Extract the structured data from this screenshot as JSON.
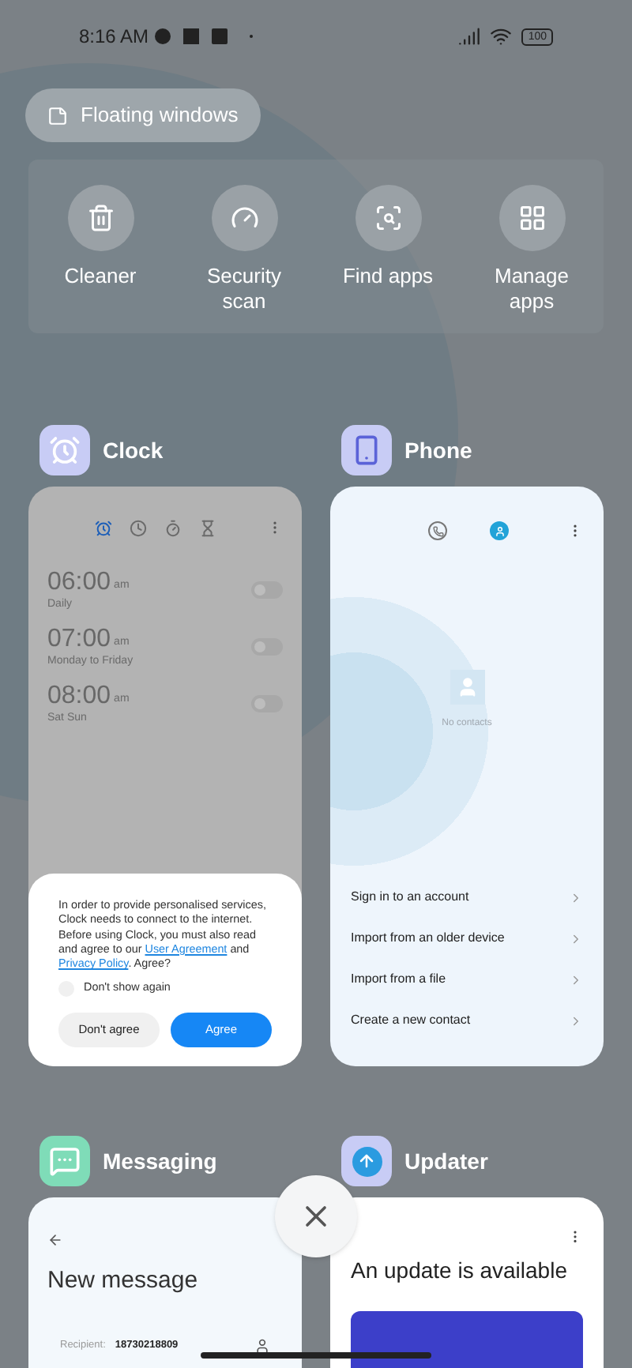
{
  "status_bar": {
    "time": "8:16 AM",
    "battery": "100"
  },
  "floating_windows": {
    "label": "Floating windows"
  },
  "shortcuts": [
    {
      "kind": "cleaner",
      "label": "Cleaner"
    },
    {
      "kind": "security",
      "label": "Security scan"
    },
    {
      "kind": "find",
      "label": "Find apps"
    },
    {
      "kind": "manage",
      "label": "Manage apps"
    }
  ],
  "apps": [
    {
      "kind": "clock",
      "name": "Clock",
      "alarms": [
        {
          "time": "06:00",
          "period": "am",
          "label": "Daily",
          "on": false
        },
        {
          "time": "07:00",
          "period": "am",
          "label": "Monday to Friday",
          "on": false
        },
        {
          "time": "08:00",
          "period": "am",
          "label": "Sat Sun",
          "on": false
        }
      ],
      "tabs": [
        {
          "kind": "alarm",
          "selected": true
        },
        {
          "kind": "clock",
          "selected": false
        },
        {
          "kind": "stopwatch",
          "selected": false
        },
        {
          "kind": "timer",
          "selected": false
        }
      ],
      "dialog": {
        "text_before": "In order to provide personalised services, Clock needs to connect to the internet. Before using Clock, you must also read and agree to our",
        "link_1": "User Agreement",
        "text_middle": "and",
        "link_2": "Privacy Policy",
        "text_after": ". Agree?",
        "checkbox": {
          "label": "Don't show again",
          "checked": false
        },
        "cancel": "Don't agree",
        "confirm": "Agree"
      }
    },
    {
      "kind": "phone",
      "name": "Phone",
      "tabs": [
        {
          "kind": "calls",
          "selected": false
        },
        {
          "kind": "contacts",
          "selected": true
        }
      ],
      "empty": "No contacts",
      "items": [
        "Sign in to an account",
        "Import from an older device",
        "Import from a file",
        "Create a new contact"
      ]
    },
    {
      "kind": "messaging",
      "name": "Messaging",
      "title": "New message",
      "recipient_label": "Recipient:",
      "recipient": "18730218809"
    },
    {
      "kind": "updater",
      "name": "Updater",
      "title": "An update is available"
    }
  ]
}
